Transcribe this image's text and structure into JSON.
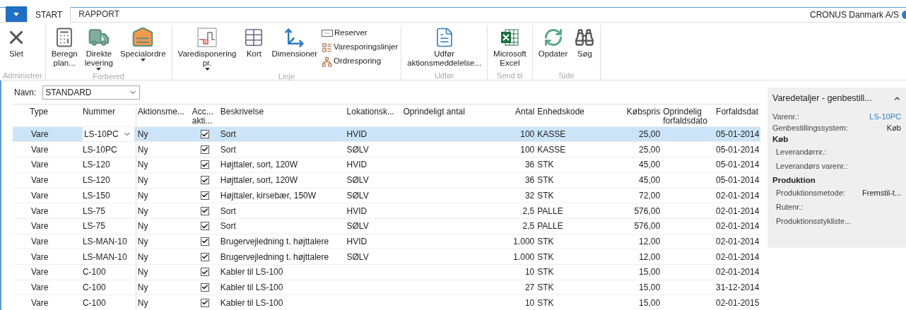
{
  "tabs": [
    {
      "label": "START",
      "selected": true
    },
    {
      "label": "RAPPORT",
      "selected": false
    }
  ],
  "company": "CRONUS Danmark A/S",
  "ribbon": [
    {
      "title": "Administrer",
      "items": [
        {
          "kind": "large",
          "label": [
            "Slet"
          ],
          "dropdown": false
        }
      ]
    },
    {
      "title": "Forbered",
      "items": [
        {
          "kind": "large",
          "label": [
            "Beregn",
            "plan..."
          ],
          "dropdown": false
        },
        {
          "kind": "large",
          "label": [
            "Direkte",
            "levering"
          ],
          "dropdown": true
        },
        {
          "kind": "large",
          "label": [
            "Specialordre"
          ],
          "dropdown": true
        }
      ]
    },
    {
      "title": "Linje",
      "items": [
        {
          "kind": "large",
          "label": [
            "Varedisponering",
            "pr."
          ],
          "dropdown": true
        },
        {
          "kind": "large",
          "label": [
            "Kort"
          ],
          "dropdown": false
        },
        {
          "kind": "large",
          "label": [
            "Dimensioner"
          ],
          "dropdown": false
        },
        {
          "kind": "small",
          "label": [
            "Reserver"
          ],
          "dropdown": false
        },
        {
          "kind": "small",
          "label": [
            "Varesporingslinjer"
          ],
          "dropdown": false
        },
        {
          "kind": "small",
          "label": [
            "Ordresporing"
          ],
          "dropdown": false
        }
      ]
    },
    {
      "title": "Udfør",
      "items": [
        {
          "kind": "large",
          "label": [
            "Udfør",
            "aktionsmeddelelse..."
          ],
          "dropdown": false
        }
      ]
    },
    {
      "title": "Send til",
      "items": [
        {
          "kind": "large",
          "label": [
            "Microsoft",
            "Excel"
          ],
          "dropdown": false
        }
      ]
    },
    {
      "title": "Side",
      "items": [
        {
          "kind": "large",
          "label": [
            "Opdater"
          ],
          "dropdown": false
        },
        {
          "kind": "large",
          "label": [
            "Søg"
          ],
          "dropdown": false
        }
      ]
    }
  ],
  "filter": {
    "label": "Navn:",
    "value": "STANDARD"
  },
  "table": {
    "columns": [
      "Type",
      "Nummer",
      "Aktionsme...",
      "Acc... akti...",
      "Beskrivelse",
      "Lokationsk...",
      "Oprindeligt antal",
      "Antal",
      "Enhedskode",
      "Købspris",
      "Oprindelig forfaldsdato",
      "Forfaldsdat"
    ],
    "rows": [
      {
        "selected": true,
        "type": "Vare",
        "number": "LS-10PC",
        "action": "Ny",
        "accept": true,
        "description": "Sort",
        "location": "HVID",
        "qty": "100",
        "unit": "KASSE",
        "price": "25,00",
        "due": "05-01-2014"
      },
      {
        "selected": false,
        "type": "Vare",
        "number": "LS-10PC",
        "action": "Ny",
        "accept": true,
        "description": "Sort",
        "location": "SØLV",
        "qty": "100",
        "unit": "KASSE",
        "price": "25,00",
        "due": "05-01-2014"
      },
      {
        "selected": false,
        "type": "Vare",
        "number": "LS-120",
        "action": "Ny",
        "accept": true,
        "description": "Højttaler, sort, 120W",
        "location": "HVID",
        "qty": "36",
        "unit": "STK",
        "price": "45,00",
        "due": "05-01-2014"
      },
      {
        "selected": false,
        "type": "Vare",
        "number": "LS-120",
        "action": "Ny",
        "accept": true,
        "description": "Højttaler, sort, 120W",
        "location": "SØLV",
        "qty": "36",
        "unit": "STK",
        "price": "45,00",
        "due": "05-01-2014"
      },
      {
        "selected": false,
        "type": "Vare",
        "number": "LS-150",
        "action": "Ny",
        "accept": true,
        "description": "Højttaler, kirsebær, 150W",
        "location": "SØLV",
        "qty": "32",
        "unit": "STK",
        "price": "72,00",
        "due": "02-01-2014"
      },
      {
        "selected": false,
        "type": "Vare",
        "number": "LS-75",
        "action": "Ny",
        "accept": true,
        "description": "Sort",
        "location": "HVID",
        "qty": "2,5",
        "unit": "PALLE",
        "price": "576,00",
        "due": "02-01-2014"
      },
      {
        "selected": false,
        "type": "Vare",
        "number": "LS-75",
        "action": "Ny",
        "accept": true,
        "description": "Sort",
        "location": "SØLV",
        "qty": "2,5",
        "unit": "PALLE",
        "price": "576,00",
        "due": "02-01-2014"
      },
      {
        "selected": false,
        "type": "Vare",
        "number": "LS-MAN-10",
        "action": "Ny",
        "accept": true,
        "description": "Brugervejledning t. højttalere",
        "location": "HVID",
        "qty": "1.000",
        "unit": "STK",
        "price": "12,00",
        "due": "02-01-2014"
      },
      {
        "selected": false,
        "type": "Vare",
        "number": "LS-MAN-10",
        "action": "Ny",
        "accept": true,
        "description": "Brugervejledning t. højttalere",
        "location": "SØLV",
        "qty": "1.000",
        "unit": "STK",
        "price": "12,00",
        "due": "02-01-2014"
      },
      {
        "selected": false,
        "type": "Vare",
        "number": "C-100",
        "action": "Ny",
        "accept": true,
        "description": "Kabler til LS-100",
        "qty": "10",
        "unit": "STK",
        "price": "15,00",
        "due": "02-01-2014"
      },
      {
        "selected": false,
        "type": "Vare",
        "number": "C-100",
        "action": "Ny",
        "accept": true,
        "description": "Kabler til LS-100",
        "qty": "27",
        "unit": "STK",
        "price": "15,00",
        "due": "31-12-2014"
      },
      {
        "selected": false,
        "type": "Vare",
        "number": "C-100",
        "action": "Ny",
        "accept": true,
        "description": "Kabler til LS-100",
        "qty": "10",
        "unit": "STK",
        "price": "15,00",
        "due": "02-01-2015"
      }
    ]
  },
  "factbox": {
    "title": "Varedetaljer - genbestill...",
    "fields": [
      {
        "kind": "field",
        "label": "Varenr.:",
        "value": "LS-10PC",
        "link": true
      },
      {
        "kind": "field",
        "label": "Genbestillingssystem:",
        "value": "Køb",
        "link": false
      },
      {
        "kind": "heading",
        "label": "Køb"
      },
      {
        "kind": "subfield",
        "label": "Leverandørnr.:"
      },
      {
        "kind": "subfield",
        "label": "Leverandørs varenr.:"
      },
      {
        "kind": "heading",
        "label": "Produktion"
      },
      {
        "kind": "subfield",
        "label": "Produktionsmetode:",
        "value": "Fremstil-t..."
      },
      {
        "kind": "subfield",
        "label": "Rutenr.:"
      },
      {
        "kind": "subfield",
        "label": "Produktionsstykliste..."
      }
    ]
  }
}
